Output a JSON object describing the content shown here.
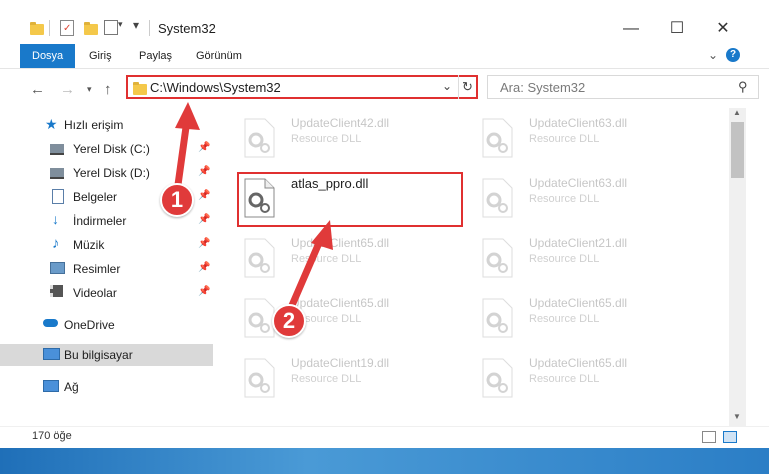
{
  "window": {
    "title": "System32"
  },
  "ribbon": {
    "tabs": [
      "Dosya",
      "Giriş",
      "Paylaş",
      "Görünüm"
    ]
  },
  "address": {
    "path": "C:\\Windows\\System32"
  },
  "search": {
    "placeholder": "Ara: System32"
  },
  "sidebar": {
    "items": [
      {
        "label": "Hızlı erişim",
        "icon": "star-icon"
      },
      {
        "label": "Yerel Disk (C:)",
        "icon": "drive-icon"
      },
      {
        "label": "Yerel Disk (D:)",
        "icon": "drive-icon"
      },
      {
        "label": "Belgeler",
        "icon": "document-icon"
      },
      {
        "label": "İndirmeler",
        "icon": "download-icon"
      },
      {
        "label": "Müzik",
        "icon": "music-icon"
      },
      {
        "label": "Resimler",
        "icon": "pictures-icon"
      },
      {
        "label": "Videolar",
        "icon": "video-icon"
      },
      {
        "label": "OneDrive",
        "icon": "cloud-icon"
      },
      {
        "label": "Bu bilgisayar",
        "icon": "computer-icon"
      },
      {
        "label": "Ağ",
        "icon": "network-icon"
      }
    ]
  },
  "files": [
    {
      "name": "UpdateClient42.dll",
      "type": "Resource DLL"
    },
    {
      "name": "UpdateClient63.dll",
      "type": "Resource DLL"
    },
    {
      "name": "atlas_ppro.dll",
      "type": ""
    },
    {
      "name": "UpdateClient63.dll",
      "type": "Resource DLL"
    },
    {
      "name": "UpdateClient65.dll",
      "type": "Resource DLL"
    },
    {
      "name": "UpdateClient21.dll",
      "type": "Resource DLL"
    },
    {
      "name": "UpdateClient65.dll",
      "type": "Resource DLL"
    },
    {
      "name": "UpdateClient65.dll",
      "type": "Resource DLL"
    },
    {
      "name": "UpdateClient19.dll",
      "type": "Resource DLL"
    },
    {
      "name": "UpdateClient65.dll",
      "type": "Resource DLL"
    }
  ],
  "status": {
    "count": "170 öğe"
  },
  "annotations": {
    "step1": "1",
    "step2": "2"
  },
  "colors": {
    "accent": "#1979ca",
    "highlight": "#e03030"
  }
}
